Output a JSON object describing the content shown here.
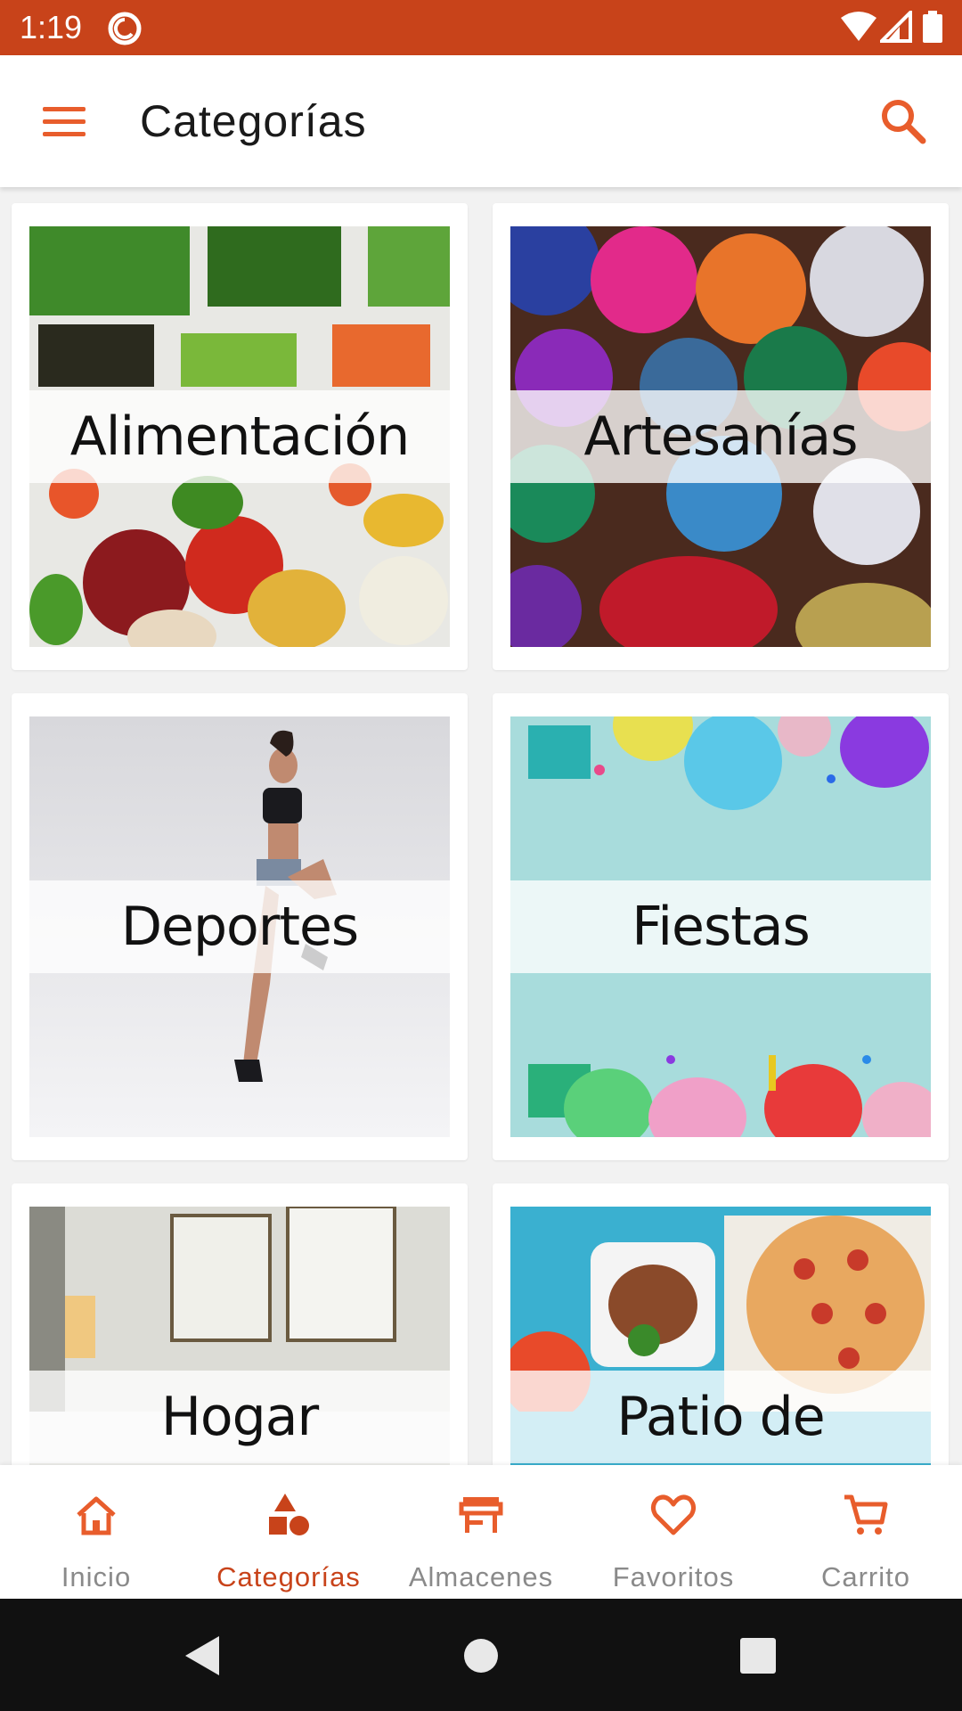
{
  "status_bar": {
    "time": "1:19"
  },
  "app_bar": {
    "title": "Categorías"
  },
  "categories": [
    {
      "label": "Alimentación"
    },
    {
      "label": "Artesanías"
    },
    {
      "label": "Deportes"
    },
    {
      "label": "Fiestas"
    },
    {
      "label": "Hogar"
    },
    {
      "label": "Patio de comidas"
    }
  ],
  "bottom_nav": {
    "items": [
      {
        "label": "Inicio",
        "icon": "home-icon"
      },
      {
        "label": "Categorías",
        "icon": "shapes-icon",
        "active": true
      },
      {
        "label": "Almacenes",
        "icon": "store-icon"
      },
      {
        "label": "Favoritos",
        "icon": "heart-icon"
      },
      {
        "label": "Carrito",
        "icon": "cart-icon"
      }
    ]
  },
  "colors": {
    "accent": "#c8431a",
    "accent_light": "#e85d2c"
  }
}
